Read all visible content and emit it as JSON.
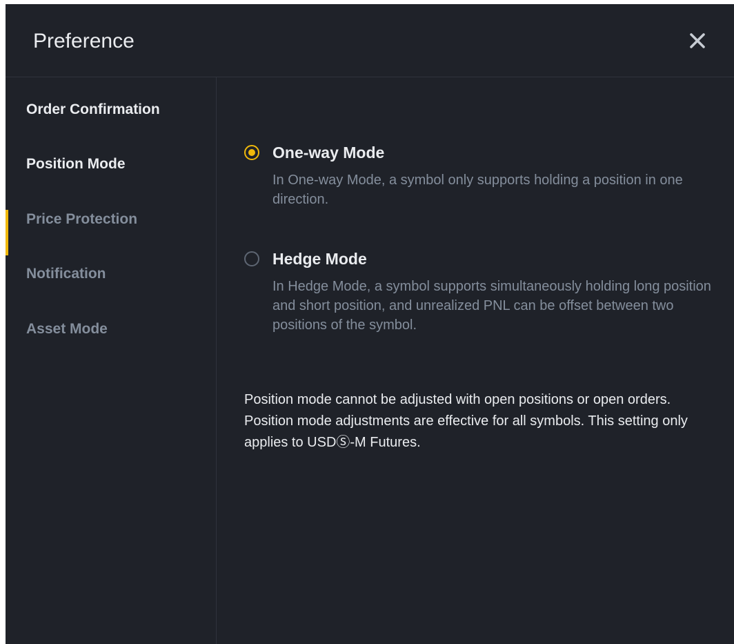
{
  "dialog": {
    "title": "Preference",
    "close_icon": "close-icon"
  },
  "sidebar": {
    "items": [
      {
        "label": "Order Confirmation",
        "active": false
      },
      {
        "label": "Position Mode",
        "active": true
      },
      {
        "label": "Price Protection",
        "active": false
      },
      {
        "label": "Notification",
        "active": false
      },
      {
        "label": "Asset Mode",
        "active": false
      }
    ]
  },
  "position_mode": {
    "options": [
      {
        "label": "One-way Mode",
        "checked": true,
        "description": "In One-way Mode, a symbol only supports holding a position in one direction."
      },
      {
        "label": "Hedge Mode",
        "checked": false,
        "description": "In Hedge Mode, a symbol supports simultaneously holding long position and short position, and unrealized PNL can be offset between two positions of the symbol."
      }
    ],
    "note": "Position mode cannot be adjusted with open positions or open orders. Position mode adjustments are effective for all symbols. This setting only applies to USDⓈ-M Futures."
  },
  "colors": {
    "background": "#1f2229",
    "accent": "#f0b90b",
    "text_primary": "#eaecef",
    "text_secondary": "#848e9c",
    "divider": "#2f333c"
  }
}
